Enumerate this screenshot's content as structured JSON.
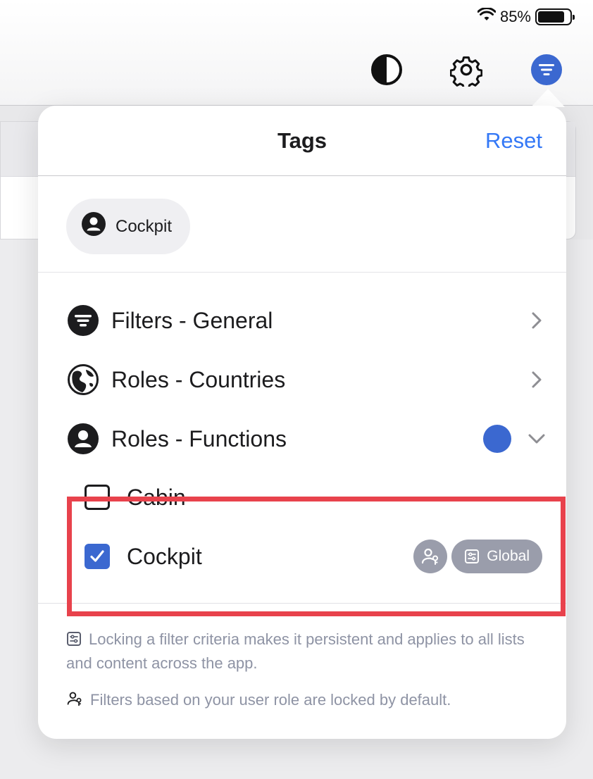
{
  "status_bar": {
    "battery_text": "85%",
    "battery_level": 0.85
  },
  "popover": {
    "title": "Tags",
    "reset_label": "Reset",
    "active_chip": {
      "label": "Cockpit",
      "icon": "person-circle-icon"
    },
    "categories": [
      {
        "label": "Filters - General",
        "icon": "filter-circle-icon",
        "state": "collapsed"
      },
      {
        "label": "Roles - Countries",
        "icon": "globe-icon",
        "state": "collapsed"
      },
      {
        "label": "Roles - Functions",
        "icon": "person-circle-icon",
        "state": "expanded",
        "has_active_dot": true
      }
    ],
    "function_options": [
      {
        "label": "Cabin",
        "checked": false
      },
      {
        "label": "Cockpit",
        "checked": true,
        "badges": {
          "role_lock_icon": "person-key-icon",
          "global_label": "Global"
        }
      }
    ],
    "notes": [
      {
        "icon": "sliders-lock-icon",
        "text": "Locking a filter criteria makes it persistent and applies to all lists and content across the app."
      },
      {
        "icon": "person-key-icon",
        "text": "Filters based on your user role are locked by default."
      }
    ]
  },
  "colors": {
    "accent": "#3b68d0",
    "link": "#3478f6",
    "highlight": "#e8424c",
    "badge": "#9a9dab"
  }
}
